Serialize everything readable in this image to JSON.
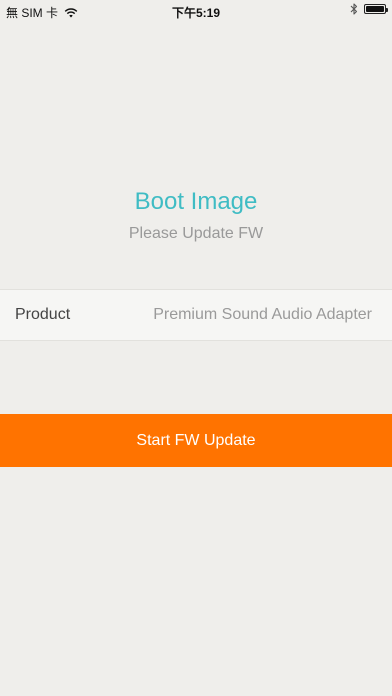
{
  "status_bar": {
    "carrier": "無 SIM 卡",
    "time": "下午5:19",
    "battery_level": 1.0
  },
  "boot": {
    "title": "Boot Image",
    "subtitle": "Please Update FW"
  },
  "product": {
    "label": "Product",
    "value": "Premium Sound Audio Adapter"
  },
  "actions": {
    "start_update_label": "Start FW Update"
  },
  "colors": {
    "background": "#efeeeb",
    "accent_teal": "#3fbcc4",
    "button_orange": "#ff7300"
  },
  "icons": [
    "wifi-icon",
    "bluetooth-icon",
    "battery-icon"
  ]
}
